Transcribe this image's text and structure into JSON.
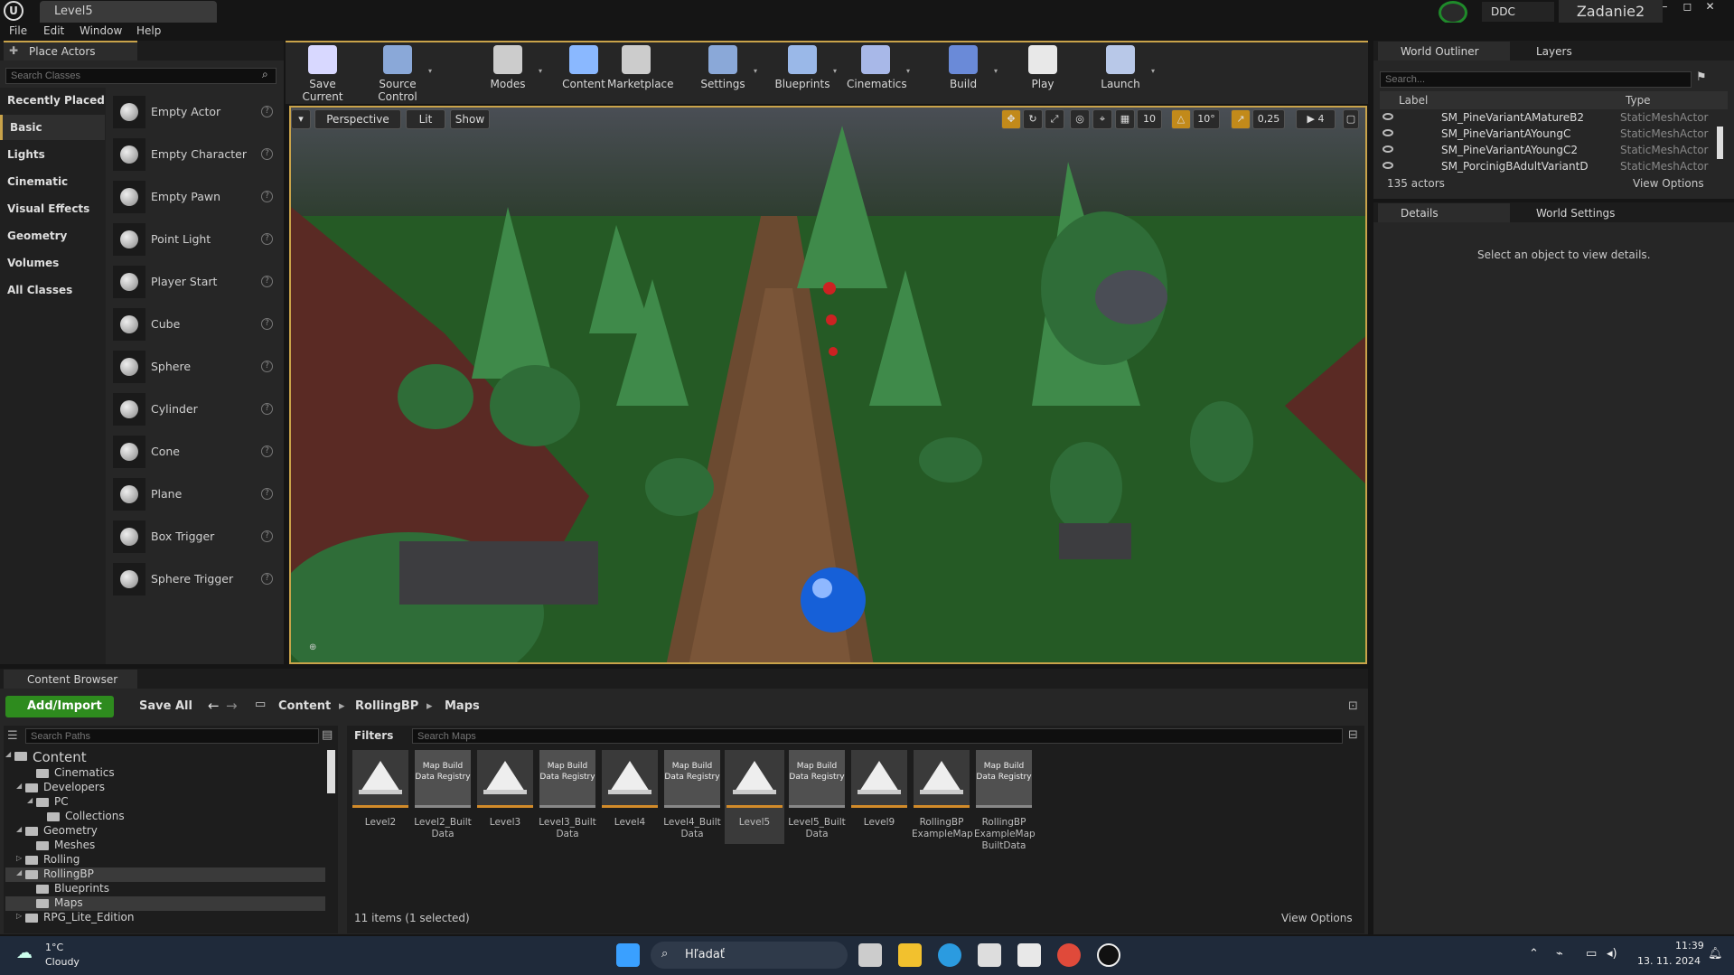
{
  "window": {
    "tab_title": "Level5",
    "ddc_label": "DDC",
    "project_name": "Zadanie2",
    "logo": "U"
  },
  "menu": [
    "File",
    "Edit",
    "Window",
    "Help"
  ],
  "place_actors": {
    "title": "Place Actors",
    "search_placeholder": "Search Classes",
    "categories": [
      "Recently Placed",
      "Basic",
      "Lights",
      "Cinematic",
      "Visual Effects",
      "Geometry",
      "Volumes",
      "All Classes"
    ],
    "selected_category": "Basic",
    "actors": [
      "Empty Actor",
      "Empty Character",
      "Empty Pawn",
      "Point Light",
      "Player Start",
      "Cube",
      "Sphere",
      "Cylinder",
      "Cone",
      "Plane",
      "Box Trigger",
      "Sphere Trigger"
    ]
  },
  "toolbar": [
    "Save Current",
    "Source Control",
    "Modes",
    "Content",
    "Marketplace",
    "Settings",
    "Blueprints",
    "Cinematics",
    "Build",
    "Play",
    "Launch"
  ],
  "viewport": {
    "perspective": "Perspective",
    "lit": "Lit",
    "show": "Show",
    "grid_snap": "10",
    "rot_snap": "10°",
    "scale_snap": "0,25",
    "cam_speed": "4"
  },
  "outliner": {
    "tab": "World Outliner",
    "tab2": "Layers",
    "search_placeholder": "Search...",
    "col_label": "Label",
    "col_type": "Type",
    "rows": [
      {
        "name": "SM_PineVariantAMatureB2",
        "type": "StaticMeshActor"
      },
      {
        "name": "SM_PineVariantAYoungC",
        "type": "StaticMeshActor"
      },
      {
        "name": "SM_PineVariantAYoungC2",
        "type": "StaticMeshActor"
      },
      {
        "name": "SM_PorcinigBAdultVariantD",
        "type": "StaticMeshActor"
      }
    ],
    "count": "135 actors",
    "view_options": "View Options"
  },
  "details": {
    "tab": "Details",
    "tab2": "World Settings",
    "empty_msg": "Select an object to view details."
  },
  "content_browser": {
    "title": "Content Browser",
    "add_import": "Add/Import",
    "save_all": "Save All",
    "path": [
      "Content",
      "RollingBP",
      "Maps"
    ],
    "search_paths_placeholder": "Search Paths",
    "filters": "Filters",
    "search_placeholder": "Search Maps",
    "tree": [
      {
        "label": "Content",
        "indent": 0,
        "arrow": "◢"
      },
      {
        "label": "Cinematics",
        "indent": 2,
        "arrow": ""
      },
      {
        "label": "Developers",
        "indent": 1,
        "arrow": "◢"
      },
      {
        "label": "PC",
        "indent": 2,
        "arrow": "◢"
      },
      {
        "label": "Collections",
        "indent": 3,
        "arrow": ""
      },
      {
        "label": "Geometry",
        "indent": 1,
        "arrow": "◢"
      },
      {
        "label": "Meshes",
        "indent": 2,
        "arrow": ""
      },
      {
        "label": "Rolling",
        "indent": 1,
        "arrow": "▷"
      },
      {
        "label": "RollingBP",
        "indent": 1,
        "arrow": "◢"
      },
      {
        "label": "Blueprints",
        "indent": 2,
        "arrow": ""
      },
      {
        "label": "Maps",
        "indent": 2,
        "arrow": ""
      },
      {
        "label": "RPG_Lite_Edition",
        "indent": 1,
        "arrow": "▷"
      }
    ],
    "assets": [
      {
        "name": "Level2",
        "kind": "map"
      },
      {
        "name": "Level2_Built Data",
        "kind": "reg"
      },
      {
        "name": "Level3",
        "kind": "map"
      },
      {
        "name": "Level3_Built Data",
        "kind": "reg"
      },
      {
        "name": "Level4",
        "kind": "map"
      },
      {
        "name": "Level4_Built Data",
        "kind": "reg"
      },
      {
        "name": "Level5",
        "kind": "map"
      },
      {
        "name": "Level5_Built Data",
        "kind": "reg"
      },
      {
        "name": "Level9",
        "kind": "map"
      },
      {
        "name": "RollingBP ExampleMap",
        "kind": "map"
      },
      {
        "name": "RollingBP ExampleMap BuiltData",
        "kind": "reg"
      }
    ],
    "registry_label": "Map Build Data Registry",
    "status": "11 items (1 selected)",
    "view_options": "View Options"
  },
  "taskbar": {
    "temp": "1°C",
    "weather": "Cloudy",
    "search": "Hľadať",
    "time": "11:39",
    "date": "13. 11. 2024"
  },
  "colors": {
    "accent": "#c9a34a",
    "add_button": "#2e8b1e",
    "asset_underline": "#d28b2a"
  }
}
